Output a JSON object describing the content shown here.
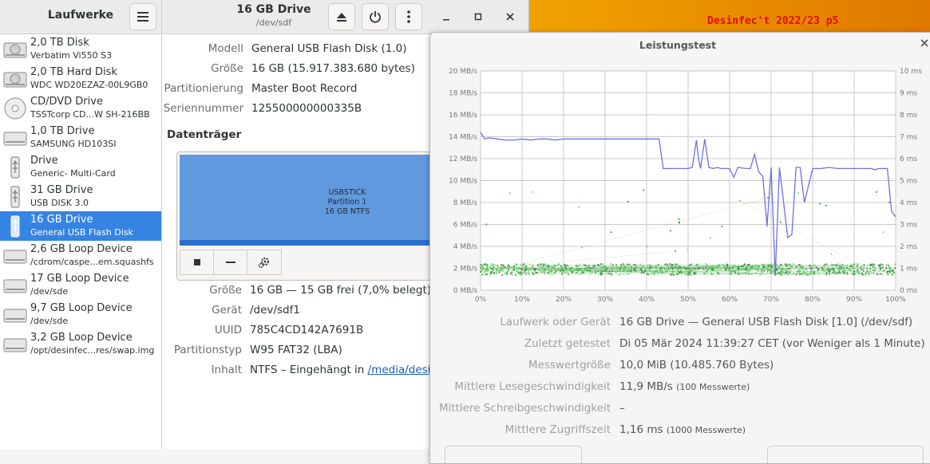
{
  "desktop": {
    "label": "Desinfec't 2022/23 p5"
  },
  "sidebar": {
    "title": "Laufwerke",
    "items": [
      {
        "name": "2,0 TB Disk",
        "sub": "Verbatim Vi550 S3",
        "icon": "hdd"
      },
      {
        "name": "2,0 TB Hard Disk",
        "sub": "WDC WD20EZAZ-00L9GB0",
        "icon": "hdd"
      },
      {
        "name": "CD/DVD Drive",
        "sub": "TSSTcorp CD...W SH-216BB",
        "icon": "disc"
      },
      {
        "name": "1,0 TB Drive",
        "sub": "SAMSUNG HD103SI",
        "icon": "drive"
      },
      {
        "name": "Drive",
        "sub": "Generic- Multi-Card",
        "icon": "usb"
      },
      {
        "name": "31 GB Drive",
        "sub": "USB DISK 3.0",
        "icon": "usb"
      },
      {
        "name": "16 GB Drive",
        "sub": "General USB Flash Disk",
        "icon": "usb",
        "selected": true
      },
      {
        "name": "2,6 GB Loop Device",
        "sub": "/cdrom/caspe...em.squashfs",
        "icon": "drive"
      },
      {
        "name": "17 GB Loop Device",
        "sub": "/dev/sde",
        "icon": "drive"
      },
      {
        "name": "9,7 GB Loop Device",
        "sub": "/dev/sde",
        "icon": "drive"
      },
      {
        "name": "3,2 GB Loop Device",
        "sub": "/opt/desinfec...res/swap.img",
        "icon": "drive"
      }
    ]
  },
  "header": {
    "title": "16 GB Drive",
    "subtitle": "/dev/sdf"
  },
  "drive_info": [
    {
      "label": "Modell",
      "value": "General USB Flash Disk (1.0)"
    },
    {
      "label": "Größe",
      "value": "16 GB (15.917.383.680 bytes)"
    },
    {
      "label": "Partitionierung",
      "value": "Master Boot Record"
    },
    {
      "label": "Seriennummer",
      "value": "125500000000335B"
    }
  ],
  "volumes": {
    "title": "Datenträger",
    "partition": {
      "line1": "USBSTICK",
      "line2": "Partition 1",
      "line3": "16 GB NTFS"
    }
  },
  "partition_info": [
    {
      "label": "Größe",
      "value": "16 GB — 15 GB frei (7,0% belegt)"
    },
    {
      "label": "Gerät",
      "value": "/dev/sdf1"
    },
    {
      "label": "UUID",
      "value": "785C4CD142A7691B"
    },
    {
      "label": "Partitionstyp",
      "value": "W95 FAT32 (LBA)"
    },
    {
      "label": "Inhalt",
      "value": "NTFS – Eingehängt in ",
      "link": "/media/desin"
    }
  ],
  "benchmark": {
    "title": "Leistungstest",
    "rows": [
      {
        "label": "Laufwerk oder Gerät",
        "value": "16 GB Drive — General USB Flash Disk [1.0] (/dev/sdf)",
        "note": ""
      },
      {
        "label": "Zuletzt getestet",
        "value": "Di 05 Mär 2024 11:39:27 CET (vor Weniger als 1 Minute)",
        "note": ""
      },
      {
        "label": "Messwertgröße",
        "value": "10,0 MiB (10.485.760 Bytes)",
        "note": ""
      },
      {
        "label": "Mittlere Lesegeschwindigkeit",
        "value": "11,9 MB/s",
        "note": "(100 Messwerte)"
      },
      {
        "label": "Mittlere Schreibgeschwindigkeit",
        "value": "–",
        "note": ""
      },
      {
        "label": "Mittlere Zugriffszeit",
        "value": "1,16 ms",
        "note": "(1000 Messwerte)"
      }
    ]
  },
  "colors": {
    "accent": "#3584e4",
    "read_line": "#7070e0",
    "access_points": "#4caf50"
  },
  "chart_data": {
    "type": "line",
    "grid": true,
    "x": {
      "ticks": [
        "0%",
        "10%",
        "20%",
        "30%",
        "40%",
        "50%",
        "60%",
        "70%",
        "80%",
        "90%",
        "100%"
      ],
      "range": [
        0,
        100
      ]
    },
    "y_left": {
      "ticks": [
        "0 MB/s",
        "2 MB/s",
        "4 MB/s",
        "6 MB/s",
        "8 MB/s",
        "10 MB/s",
        "12 MB/s",
        "14 MB/s",
        "16 MB/s",
        "18 MB/s",
        "20 MB/s"
      ],
      "range": [
        0,
        20
      ]
    },
    "y_right": {
      "ticks": [
        "0 ms",
        "1 ms",
        "2 ms",
        "3 ms",
        "4 ms",
        "5 ms",
        "6 ms",
        "7 ms",
        "8 ms",
        "9 ms",
        "10 ms"
      ],
      "range": [
        0,
        10
      ]
    },
    "read_series": {
      "x": [
        0,
        1,
        2,
        4,
        6,
        8,
        10,
        12,
        14,
        16,
        18,
        20,
        22,
        24,
        26,
        28,
        30,
        32,
        34,
        36,
        38,
        40,
        43,
        44,
        46,
        48,
        50,
        51,
        52,
        52.5,
        53,
        54,
        55,
        56,
        57,
        58,
        60,
        61,
        62,
        64,
        65,
        66,
        67,
        68,
        69,
        70,
        71,
        72,
        73,
        74,
        75,
        76,
        77,
        78,
        80,
        82,
        84,
        86,
        88,
        90,
        92,
        93,
        94,
        95,
        96,
        97,
        98,
        99,
        100
      ],
      "y": [
        14.4,
        13.8,
        13.9,
        13.8,
        13.7,
        13.7,
        13.8,
        13.7,
        13.8,
        13.8,
        13.7,
        13.8,
        13.8,
        13.8,
        13.8,
        13.8,
        13.8,
        13.8,
        13.8,
        13.8,
        13.8,
        13.8,
        13.8,
        11.1,
        11.1,
        11.1,
        11.1,
        11.2,
        13.7,
        12,
        11.1,
        13.8,
        11.2,
        11.1,
        11.2,
        11.1,
        11.1,
        10.3,
        11.2,
        11.1,
        11.1,
        12.4,
        10.8,
        10.4,
        5.8,
        11.2,
        1.3,
        11.2,
        8,
        4.8,
        5.1,
        11.2,
        11.2,
        8,
        11.1,
        11.1,
        11.2,
        11.1,
        11.1,
        11.1,
        11.1,
        11.1,
        11.1,
        11,
        11.1,
        11.1,
        11.1,
        7.2,
        6.7
      ]
    },
    "access_time": {
      "typical_ms": [
        0.7,
        1.2
      ],
      "count": 1000
    }
  }
}
